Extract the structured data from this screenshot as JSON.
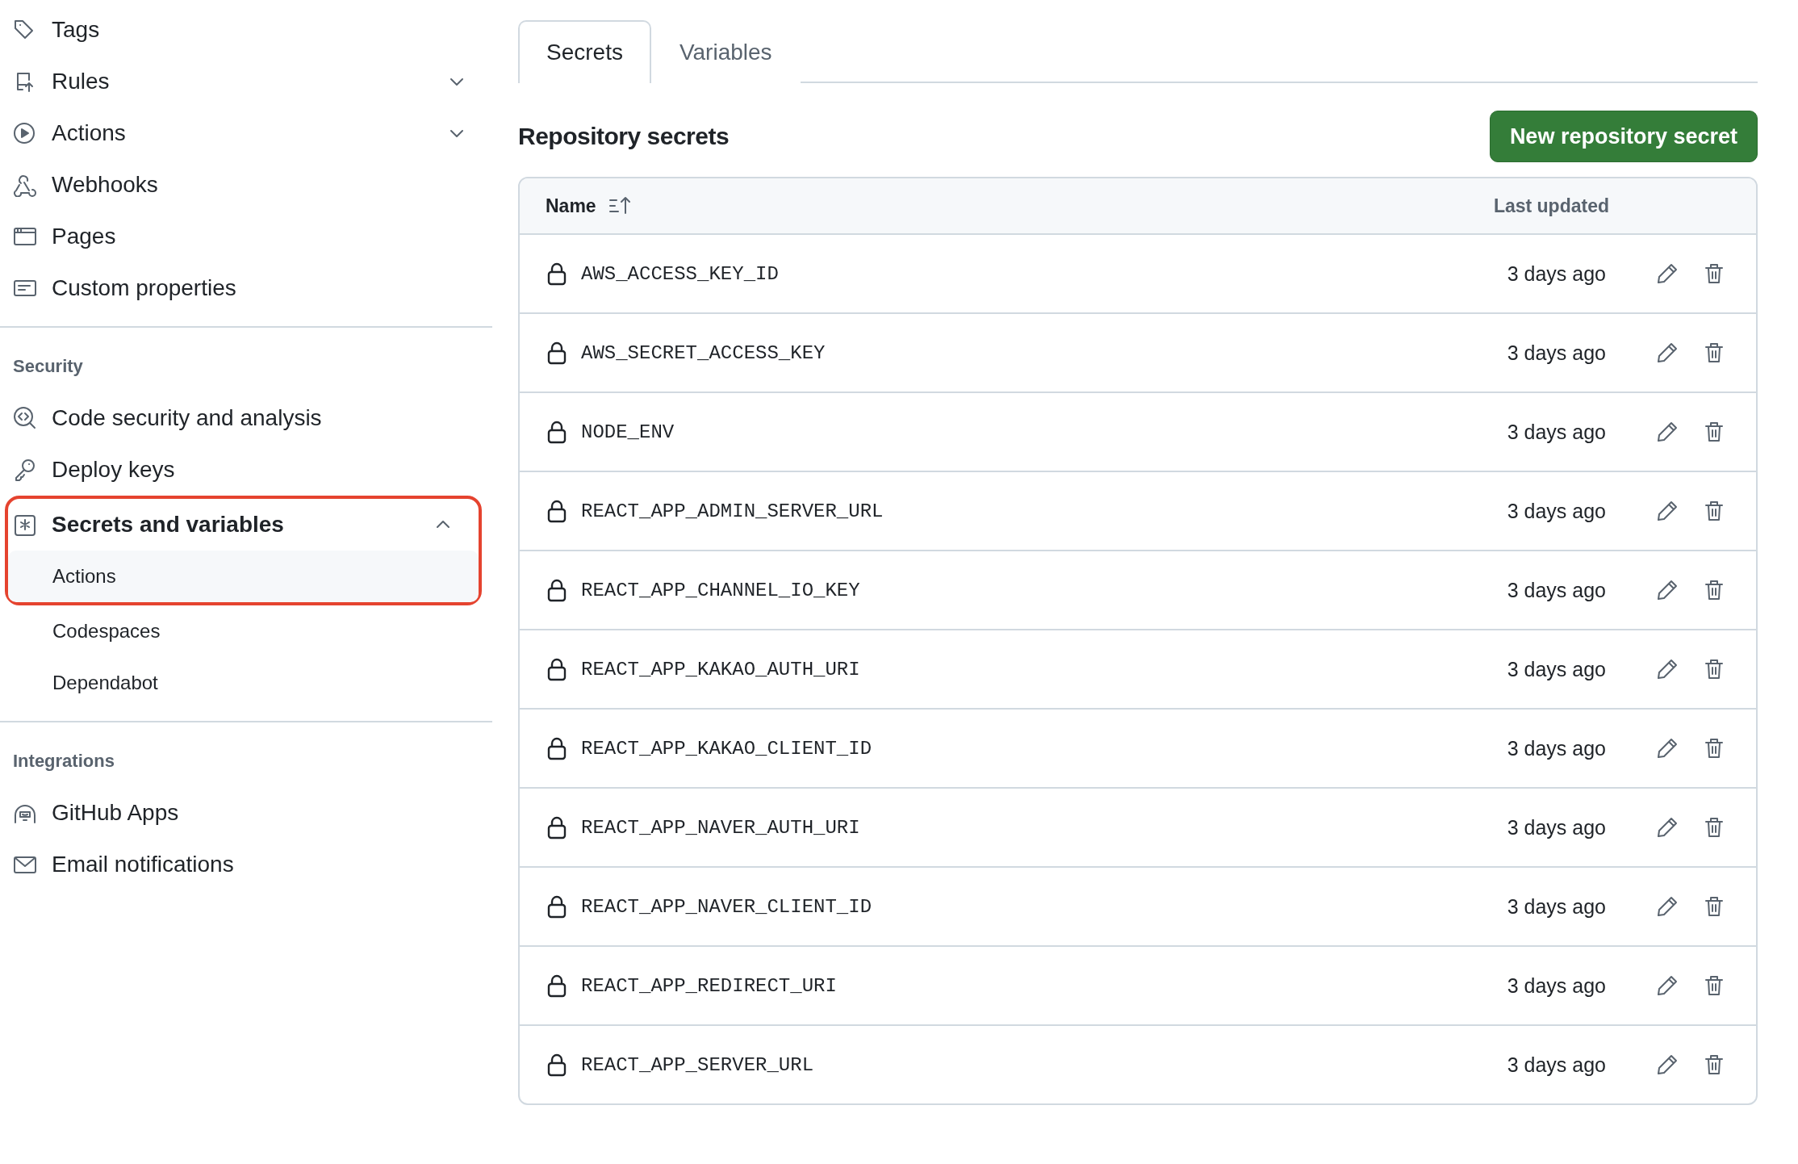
{
  "sidebar": {
    "sections": [
      {
        "items": [
          {
            "label": "Tags",
            "kind": "tag"
          },
          {
            "label": "Rules",
            "kind": "rules",
            "expanded": false
          },
          {
            "label": "Actions",
            "kind": "play",
            "expanded": false
          },
          {
            "label": "Webhooks",
            "kind": "webhook"
          },
          {
            "label": "Pages",
            "kind": "browser"
          },
          {
            "label": "Custom properties",
            "kind": "note"
          }
        ]
      },
      {
        "title": "Security",
        "items": [
          {
            "label": "Code security and analysis",
            "kind": "codescan"
          },
          {
            "label": "Deploy keys",
            "kind": "key"
          },
          {
            "label": "Secrets and variables",
            "kind": "asterisk",
            "expanded": true,
            "current": true,
            "highlighted": true,
            "children": [
              {
                "label": "Actions",
                "selected": true,
                "highlighted": true
              },
              {
                "label": "Codespaces",
                "selected": false,
                "highlighted": false
              },
              {
                "label": "Dependabot",
                "selected": false,
                "highlighted": false
              }
            ]
          }
        ]
      },
      {
        "title": "Integrations",
        "items": [
          {
            "label": "GitHub Apps",
            "kind": "apps"
          },
          {
            "label": "Email notifications",
            "kind": "mail"
          }
        ]
      }
    ]
  },
  "tabs": [
    {
      "label": "Secrets",
      "selected": true
    },
    {
      "label": "Variables",
      "selected": false
    }
  ],
  "heading": "Repository secrets",
  "new_button": "New repository secret",
  "table": {
    "columns": [
      "Name",
      "Last updated"
    ],
    "rows": [
      {
        "name": "AWS_ACCESS_KEY_ID",
        "updated": "3 days ago"
      },
      {
        "name": "AWS_SECRET_ACCESS_KEY",
        "updated": "3 days ago"
      },
      {
        "name": "NODE_ENV",
        "updated": "3 days ago"
      },
      {
        "name": "REACT_APP_ADMIN_SERVER_URL",
        "updated": "3 days ago"
      },
      {
        "name": "REACT_APP_CHANNEL_IO_KEY",
        "updated": "3 days ago"
      },
      {
        "name": "REACT_APP_KAKAO_AUTH_URI",
        "updated": "3 days ago"
      },
      {
        "name": "REACT_APP_KAKAO_CLIENT_ID",
        "updated": "3 days ago"
      },
      {
        "name": "REACT_APP_NAVER_AUTH_URI",
        "updated": "3 days ago"
      },
      {
        "name": "REACT_APP_NAVER_CLIENT_ID",
        "updated": "3 days ago"
      },
      {
        "name": "REACT_APP_REDIRECT_URI",
        "updated": "3 days ago"
      },
      {
        "name": "REACT_APP_SERVER_URL",
        "updated": "3 days ago"
      }
    ]
  }
}
